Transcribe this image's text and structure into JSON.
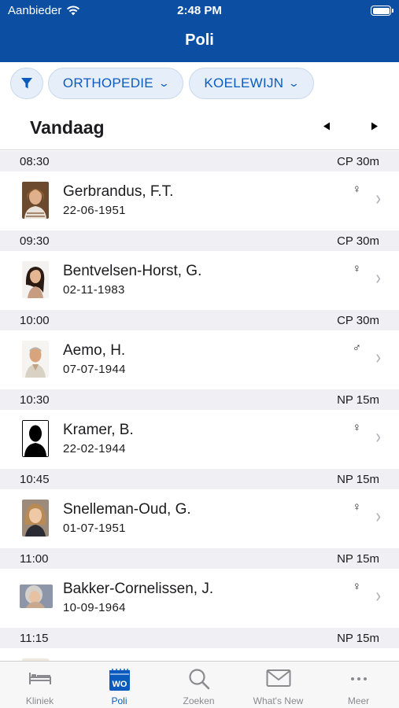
{
  "status_bar": {
    "carrier": "Aanbieder",
    "time": "2:48 PM"
  },
  "nav": {
    "title": "Poli"
  },
  "filters": {
    "filter_icon": "filter-icon",
    "department": "ORTHOPEDIE",
    "doctor": "KOELEWIJN"
  },
  "date_nav": {
    "label": "Vandaag",
    "prev_icon": "triangle-left",
    "next_icon": "triangle-right"
  },
  "appointments": [
    {
      "time": "08:30",
      "type": "CP  30m",
      "name": "Gerbrandus, F.T.",
      "dob": "22-06-1951",
      "gender": "♀"
    },
    {
      "time": "09:30",
      "type": "CP  30m",
      "name": "Bentvelsen-Horst, G.",
      "dob": "02-11-1983",
      "gender": "♀"
    },
    {
      "time": "10:00",
      "type": "CP  30m",
      "name": "Aemo, H.",
      "dob": "07-07-1944",
      "gender": "♂"
    },
    {
      "time": "10:30",
      "type": "NP  15m",
      "name": "Kramer, B.",
      "dob": "22-02-1944",
      "gender": "♀"
    },
    {
      "time": "10:45",
      "type": "NP  15m",
      "name": "Snelleman-Oud, G.",
      "dob": "01-07-1951",
      "gender": "♀"
    },
    {
      "time": "11:00",
      "type": "NP  15m",
      "name": "Bakker-Cornelissen, J.",
      "dob": "10-09-1964",
      "gender": "♀"
    },
    {
      "time": "11:15",
      "type": "NP  15m",
      "name": "",
      "dob": "",
      "gender": ""
    }
  ],
  "tabbar": [
    {
      "label": "Kliniek",
      "icon": "bed-icon"
    },
    {
      "label": "Poli",
      "icon": "calendar-wo-icon",
      "badge": "WO"
    },
    {
      "label": "Zoeken",
      "icon": "search-icon"
    },
    {
      "label": "What's New",
      "icon": "mail-icon"
    },
    {
      "label": "Meer",
      "icon": "more-icon"
    }
  ],
  "colors": {
    "brand": "#0b4ea2",
    "accent": "#0b5bbf",
    "section_bg": "#efeff4"
  }
}
